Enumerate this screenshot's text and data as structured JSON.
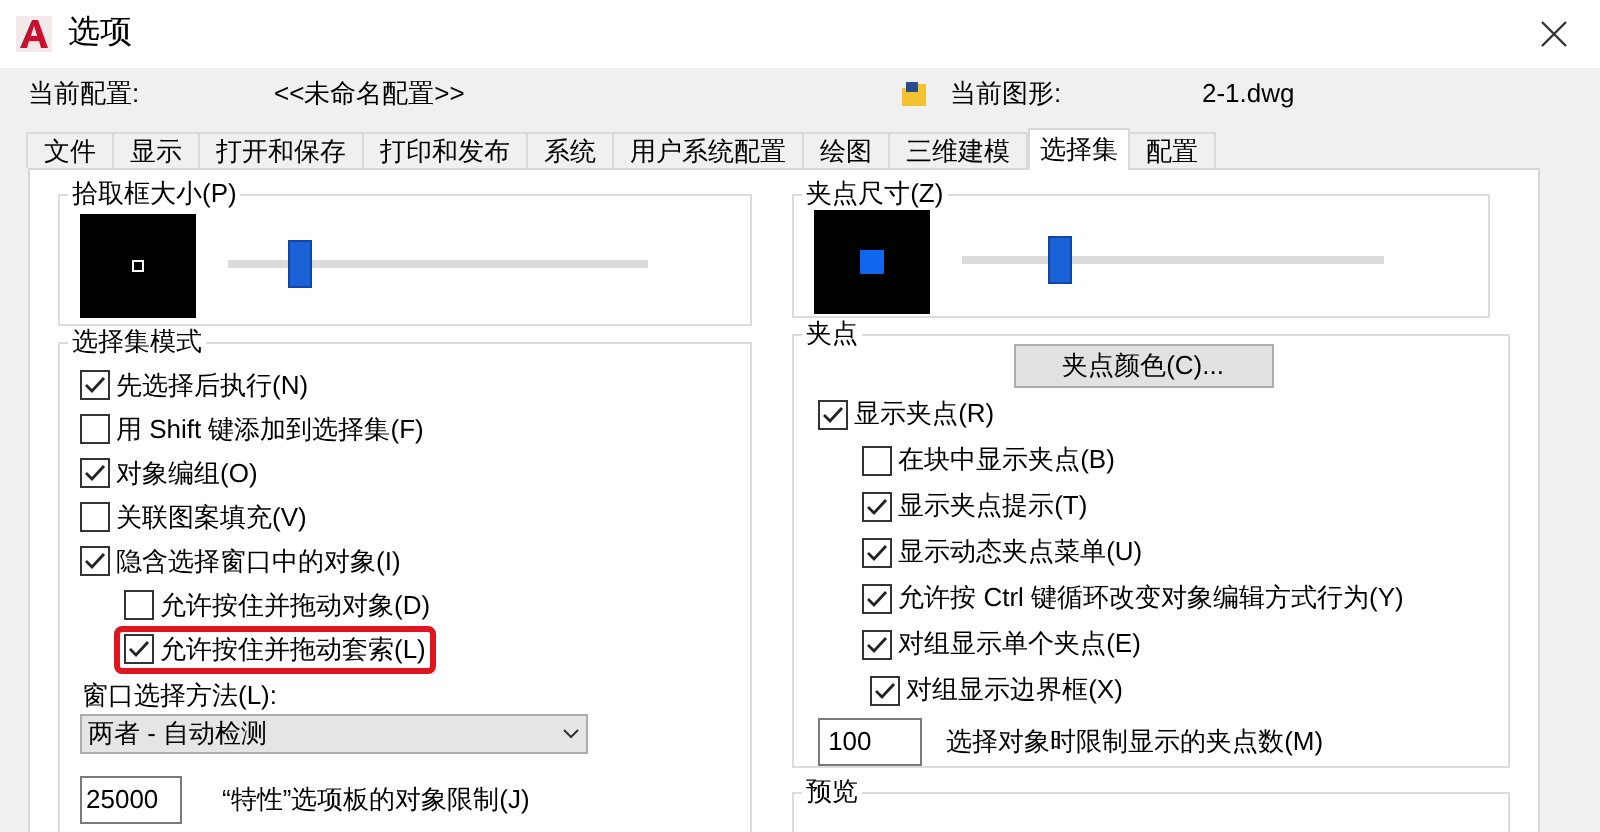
{
  "window": {
    "title": "选项"
  },
  "header": {
    "profile_label": "当前配置:",
    "profile_value": "<<未命名配置>>",
    "drawing_label": "当前图形:",
    "drawing_value": "2-1.dwg"
  },
  "tabs": [
    {
      "label": "文件",
      "selected": false
    },
    {
      "label": "显示",
      "selected": false
    },
    {
      "label": "打开和保存",
      "selected": false
    },
    {
      "label": "打印和发布",
      "selected": false
    },
    {
      "label": "系统",
      "selected": false
    },
    {
      "label": "用户系统配置",
      "selected": false
    },
    {
      "label": "绘图",
      "selected": false
    },
    {
      "label": "三维建模",
      "selected": false
    },
    {
      "label": "选择集",
      "selected": true
    },
    {
      "label": "配置",
      "selected": false
    }
  ],
  "pickbox": {
    "title": "拾取框大小(P)",
    "level": 0.17
  },
  "grip_size": {
    "title": "夹点尺寸(Z)",
    "level": 0.23
  },
  "selection_modes": {
    "title": "选择集模式",
    "items": [
      {
        "label": "先选择后执行(N)",
        "checked": true,
        "highlighted": false
      },
      {
        "label": "用 Shift 键添加到选择集(F)",
        "checked": false,
        "highlighted": false
      },
      {
        "label": "对象编组(O)",
        "checked": true,
        "highlighted": false
      },
      {
        "label": "关联图案填充(V)",
        "checked": false,
        "highlighted": false
      },
      {
        "label": "隐含选择窗口中的对象(I)",
        "checked": true,
        "highlighted": false,
        "children": [
          {
            "label": "允许按住并拖动对象(D)",
            "checked": false,
            "highlighted": false
          },
          {
            "label": "允许按住并拖动套索(L)",
            "checked": true,
            "highlighted": true
          }
        ]
      }
    ],
    "window_method_label": "窗口选择方法(L):",
    "window_method_value": "两者 - 自动检测",
    "limit_value": "25000",
    "limit_label": "“特性”选项板的对象限制(J)"
  },
  "grips": {
    "title": "夹点",
    "color_button": "夹点颜色(C)...",
    "items": [
      {
        "label": "显示夹点(R)",
        "checked": true,
        "children": [
          {
            "label": "在块中显示夹点(B)",
            "checked": false
          },
          {
            "label": "显示夹点提示(T)",
            "checked": true
          },
          {
            "label": "显示动态夹点菜单(U)",
            "checked": true
          },
          {
            "label": "允许按 Ctrl 键循环改变对象编辑方式行为(Y)",
            "checked": true
          },
          {
            "label": "对组显示单个夹点(E)",
            "checked": true,
            "children": [
              {
                "label": "对组显示边界框(X)",
                "checked": true
              }
            ]
          }
        ]
      }
    ],
    "limit_value": "100",
    "limit_label": "选择对象时限制显示的夹点数(M)"
  },
  "preview": {
    "title": "预览"
  }
}
